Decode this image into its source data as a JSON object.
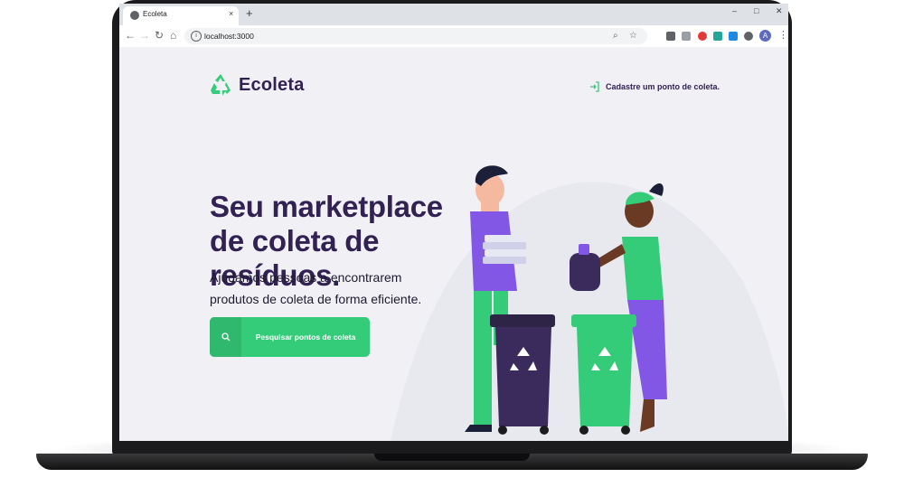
{
  "browser": {
    "tab_title": "Ecoleta",
    "tab_close": "×",
    "new_tab": "+",
    "url": "localhost:3000",
    "avatar_letter": "A",
    "window_controls": {
      "minimize": "–",
      "maximize": "□",
      "close": "✕"
    }
  },
  "app": {
    "brand": "Ecoleta",
    "header_link": "Cadastre um ponto de coleta.",
    "hero_title": "Seu marketplace de coleta de resíduos.",
    "hero_description": "Ajudamos pessoas a encontrarem produtos de coleta de forma eficiente.",
    "cta_label": "Pesquisar pontos de coleta"
  },
  "colors": {
    "primary": "#34cb79",
    "title": "#322153",
    "background": "#f0f0f5"
  },
  "icons": [
    "recycle-icon",
    "login-icon",
    "search-icon"
  ]
}
